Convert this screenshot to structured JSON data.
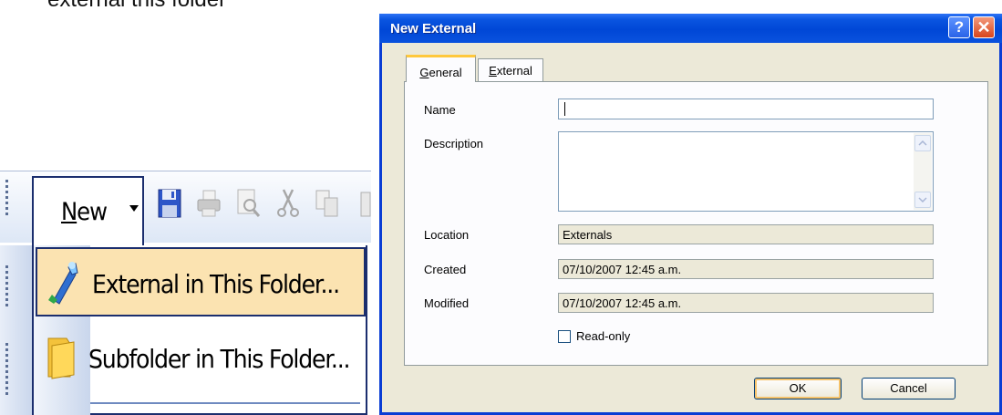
{
  "caption": "external this folder",
  "toolbar": {
    "new_label_first": "N",
    "new_label_rest": "ew",
    "icons": [
      "save-icon",
      "print-icon",
      "print-preview-icon",
      "cut-icon",
      "copy-icon",
      "paste-icon"
    ]
  },
  "menu": {
    "items": [
      {
        "label": "External in This Folder...",
        "icon": "external-wand-icon"
      },
      {
        "label": "Subfolder in This Folder...",
        "icon": "folder-icon"
      }
    ]
  },
  "dialog": {
    "title": "New External",
    "help_glyph": "?",
    "close_glyph": "✕",
    "tabs": [
      {
        "label": "General",
        "active": true
      },
      {
        "label": "External",
        "active": false
      }
    ],
    "fields": {
      "name_label": "Name",
      "name_value": "",
      "description_label": "Description",
      "description_value": "",
      "location_label": "Location",
      "location_value": "Externals",
      "created_label": "Created",
      "created_value": "07/10/2007 12:45 a.m.",
      "modified_label": "Modified",
      "modified_value": "07/10/2007 12:45 a.m.",
      "readonly_label": "Read-only",
      "readonly_checked": false
    },
    "buttons": {
      "ok": "OK",
      "cancel": "Cancel"
    }
  },
  "colors": {
    "titlebar": "#0047d6",
    "dialog_bg": "#ece9d8",
    "menu_highlight": "#fbe3b1",
    "menu_border": "#1b2e6e"
  }
}
